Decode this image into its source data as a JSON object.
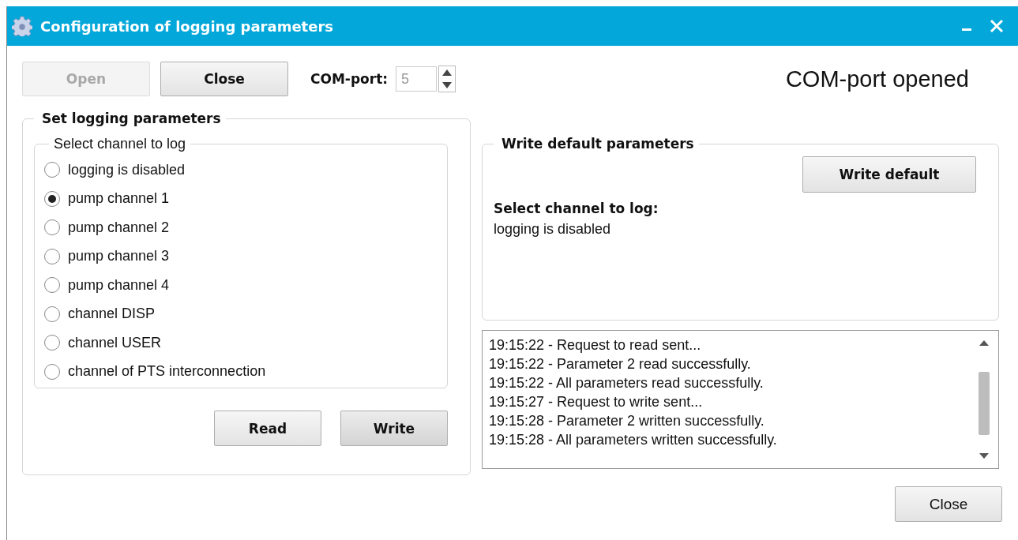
{
  "window": {
    "title": "Configuration of logging parameters"
  },
  "top_buttons": [
    {
      "label": "Open",
      "disabled": true
    },
    {
      "label": "Close",
      "disabled": false
    }
  ],
  "com_port": {
    "label": "COM-port:",
    "value": "5",
    "disabled": true
  },
  "status": "COM-port opened",
  "logging_group": {
    "title": "Set logging parameters",
    "channel_group": {
      "title": "Select channel to log",
      "options": [
        {
          "label": "logging is disabled",
          "selected": false
        },
        {
          "label": "pump channel 1",
          "selected": true
        },
        {
          "label": "pump channel 2",
          "selected": false
        },
        {
          "label": "pump channel 3",
          "selected": false
        },
        {
          "label": "pump channel 4",
          "selected": false
        },
        {
          "label": "channel DISP",
          "selected": false
        },
        {
          "label": "channel USER",
          "selected": false
        },
        {
          "label": "channel of PTS interconnection",
          "selected": false
        }
      ]
    },
    "buttons": [
      {
        "label": "Read",
        "hovered": false
      },
      {
        "label": "Write",
        "hovered": true
      }
    ]
  },
  "defaults_group": {
    "title": "Write default parameters",
    "button": "Write default",
    "heading": "Select channel to log:",
    "value": "logging is disabled"
  },
  "log": [
    "19:15:22 - Request to read sent...",
    "19:15:22 - Parameter 2 read successfully.",
    "19:15:22 - All parameters read successfully.",
    "19:15:27 - Request to write sent...",
    "19:15:28 - Parameter 2 written successfully.",
    "19:15:28 - All parameters written successfully."
  ],
  "footer_button": "Close"
}
